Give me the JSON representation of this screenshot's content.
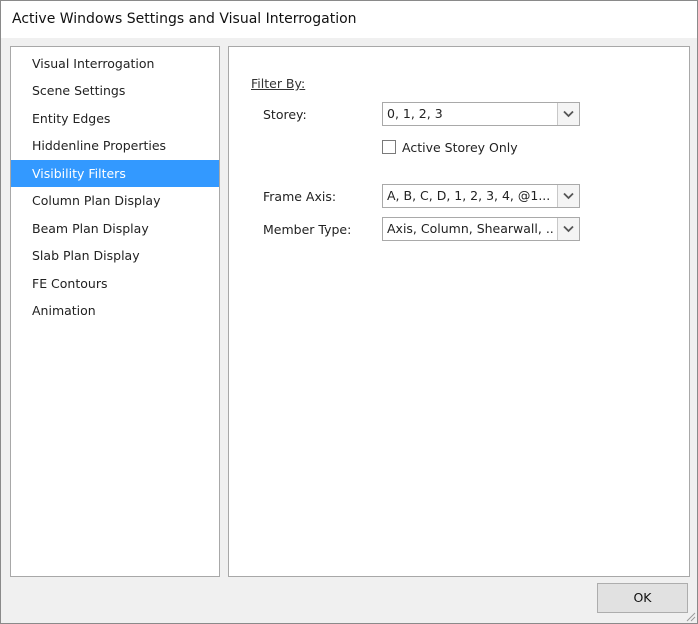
{
  "window": {
    "title": "Active Windows Settings and Visual Interrogation"
  },
  "sidebar": {
    "selected_index": 4,
    "items": [
      {
        "label": "Visual Interrogation"
      },
      {
        "label": "Scene Settings"
      },
      {
        "label": "Entity Edges"
      },
      {
        "label": "Hiddenline Properties"
      },
      {
        "label": "Visibility Filters"
      },
      {
        "label": "Column Plan Display"
      },
      {
        "label": "Beam Plan Display"
      },
      {
        "label": "Slab Plan Display"
      },
      {
        "label": "FE Contours"
      },
      {
        "label": "Animation"
      }
    ]
  },
  "filters": {
    "heading": "Filter By:",
    "storey": {
      "label": "Storey:",
      "value": "0, 1, 2, 3"
    },
    "active_storey_only": {
      "label": "Active Storey Only",
      "checked": false
    },
    "frame_axis": {
      "label": "Frame Axis:",
      "value": "A, B, C, D, 1, 2, 3, 4, @1..."
    },
    "member_type": {
      "label": "Member Type:",
      "value": "Axis, Column, Shearwall, ..."
    }
  },
  "footer": {
    "ok_label": "OK"
  },
  "colors": {
    "selection": "#3399ff",
    "dialog_background": "#f0f0f0",
    "panel_border": "#a8a8a8"
  },
  "icons": {
    "dropdown": "chevron-down-icon",
    "resize": "resize-grip-icon"
  }
}
